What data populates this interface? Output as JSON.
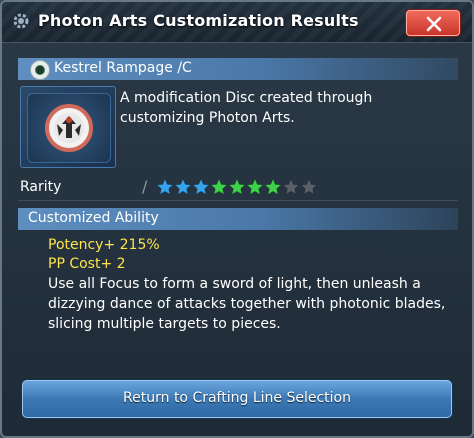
{
  "window": {
    "title": "Photon Arts Customization Results"
  },
  "item": {
    "name": "Kestrel Rampage /C",
    "description": "A modification Disc created through customizing Photon Arts."
  },
  "rarity": {
    "label": "Rarity",
    "stars_total": 9,
    "stars_filled": 7,
    "star_colors": [
      "#35a4ec",
      "#35a4ec",
      "#35a4ec",
      "#3ed24a",
      "#3ed24a",
      "#3ed24a",
      "#3ed24a",
      "#5a6068",
      "#5a6068"
    ]
  },
  "ability": {
    "section_title": "Customized Ability",
    "stats": [
      "Potency+ 215%",
      "PP Cost+ 2"
    ],
    "description": "Use all Focus to form a sword of light, then unleash a dizzying dance of attacks together with photonic blades, slicing multiple targets to pieces."
  },
  "footer": {
    "return_label": "Return to Crafting Line Selection"
  },
  "icons": {
    "title": "gear-icon",
    "close": "close-icon",
    "disc": "disc-icon",
    "thumbnail": "disc-emblem-icon"
  },
  "colors": {
    "close_button": "#d94434",
    "section_bar": "#5e8fc0",
    "stat_text": "#ffe44a",
    "return_button": "#3c78b4"
  }
}
